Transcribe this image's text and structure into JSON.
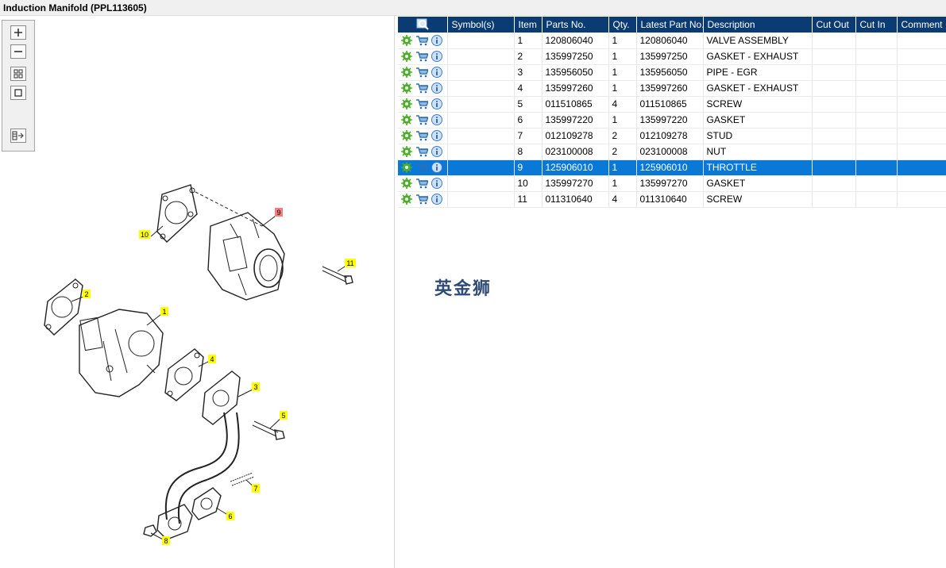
{
  "window": {
    "title": "Induction Manifold (PPL113605)"
  },
  "toolbar": {
    "buttons": [
      {
        "name": "zoom-in-icon",
        "glyph": "+"
      },
      {
        "name": "zoom-out-icon",
        "glyph": "−"
      },
      {
        "name": "fit-all-icon",
        "glyph": "grid"
      },
      {
        "name": "fit-window-icon",
        "glyph": "square"
      },
      {
        "name": "export-list-icon",
        "glyph": "list-arrow"
      }
    ]
  },
  "diagram": {
    "callouts": [
      {
        "label": "1",
        "highlighted": false
      },
      {
        "label": "2",
        "highlighted": false
      },
      {
        "label": "3",
        "highlighted": false
      },
      {
        "label": "4",
        "highlighted": false
      },
      {
        "label": "5",
        "highlighted": false
      },
      {
        "label": "6",
        "highlighted": false
      },
      {
        "label": "7",
        "highlighted": false
      },
      {
        "label": "8",
        "highlighted": false
      },
      {
        "label": "9",
        "highlighted": true
      },
      {
        "label": "10",
        "highlighted": false
      },
      {
        "label": "11",
        "highlighted": false
      }
    ],
    "colors": {
      "callout": "#ffff00",
      "callout_selected": "#f08080",
      "line": "#333333"
    }
  },
  "table": {
    "headers": {
      "search": "search-table-icon",
      "symbols": "Symbol(s)",
      "item": "Item",
      "part_no": "Parts No.",
      "qty": "Qty.",
      "latest": "Latest Part No.",
      "description": "Description",
      "cut_out": "Cut Out",
      "cut_in": "Cut In",
      "comment": "Comment"
    },
    "rows": [
      {
        "item": "1",
        "part_no": "120806040",
        "qty": "1",
        "latest": "120806040",
        "description": "VALVE ASSEMBLY",
        "selected": false
      },
      {
        "item": "2",
        "part_no": "135997250",
        "qty": "1",
        "latest": "135997250",
        "description": "GASKET - EXHAUST",
        "selected": false
      },
      {
        "item": "3",
        "part_no": "135956050",
        "qty": "1",
        "latest": "135956050",
        "description": "PIPE - EGR",
        "selected": false
      },
      {
        "item": "4",
        "part_no": "135997260",
        "qty": "1",
        "latest": "135997260",
        "description": "GASKET - EXHAUST",
        "selected": false
      },
      {
        "item": "5",
        "part_no": "011510865",
        "qty": "4",
        "latest": "011510865",
        "description": "SCREW",
        "selected": false
      },
      {
        "item": "6",
        "part_no": "135997220",
        "qty": "1",
        "latest": "135997220",
        "description": "GASKET",
        "selected": false
      },
      {
        "item": "7",
        "part_no": "012109278",
        "qty": "2",
        "latest": "012109278",
        "description": "STUD",
        "selected": false
      },
      {
        "item": "8",
        "part_no": "023100008",
        "qty": "2",
        "latest": "023100008",
        "description": "NUT",
        "selected": false
      },
      {
        "item": "9",
        "part_no": "125906010",
        "qty": "1",
        "latest": "125906010",
        "description": "THROTTLE",
        "selected": true
      },
      {
        "item": "10",
        "part_no": "135997270",
        "qty": "1",
        "latest": "135997270",
        "description": "GASKET",
        "selected": false
      },
      {
        "item": "11",
        "part_no": "011310640",
        "qty": "4",
        "latest": "011310640",
        "description": "SCREW",
        "selected": false
      }
    ],
    "row_icons": [
      "gear-icon",
      "cart-icon",
      "info-icon"
    ],
    "colors": {
      "header_bg": "#0a3b73",
      "selected_bg": "#0a78d7",
      "gear": "#4caf2a",
      "cart": "#2a6fb8",
      "info": "#3a7fd0"
    }
  },
  "watermark": {
    "text": "英金狮"
  }
}
